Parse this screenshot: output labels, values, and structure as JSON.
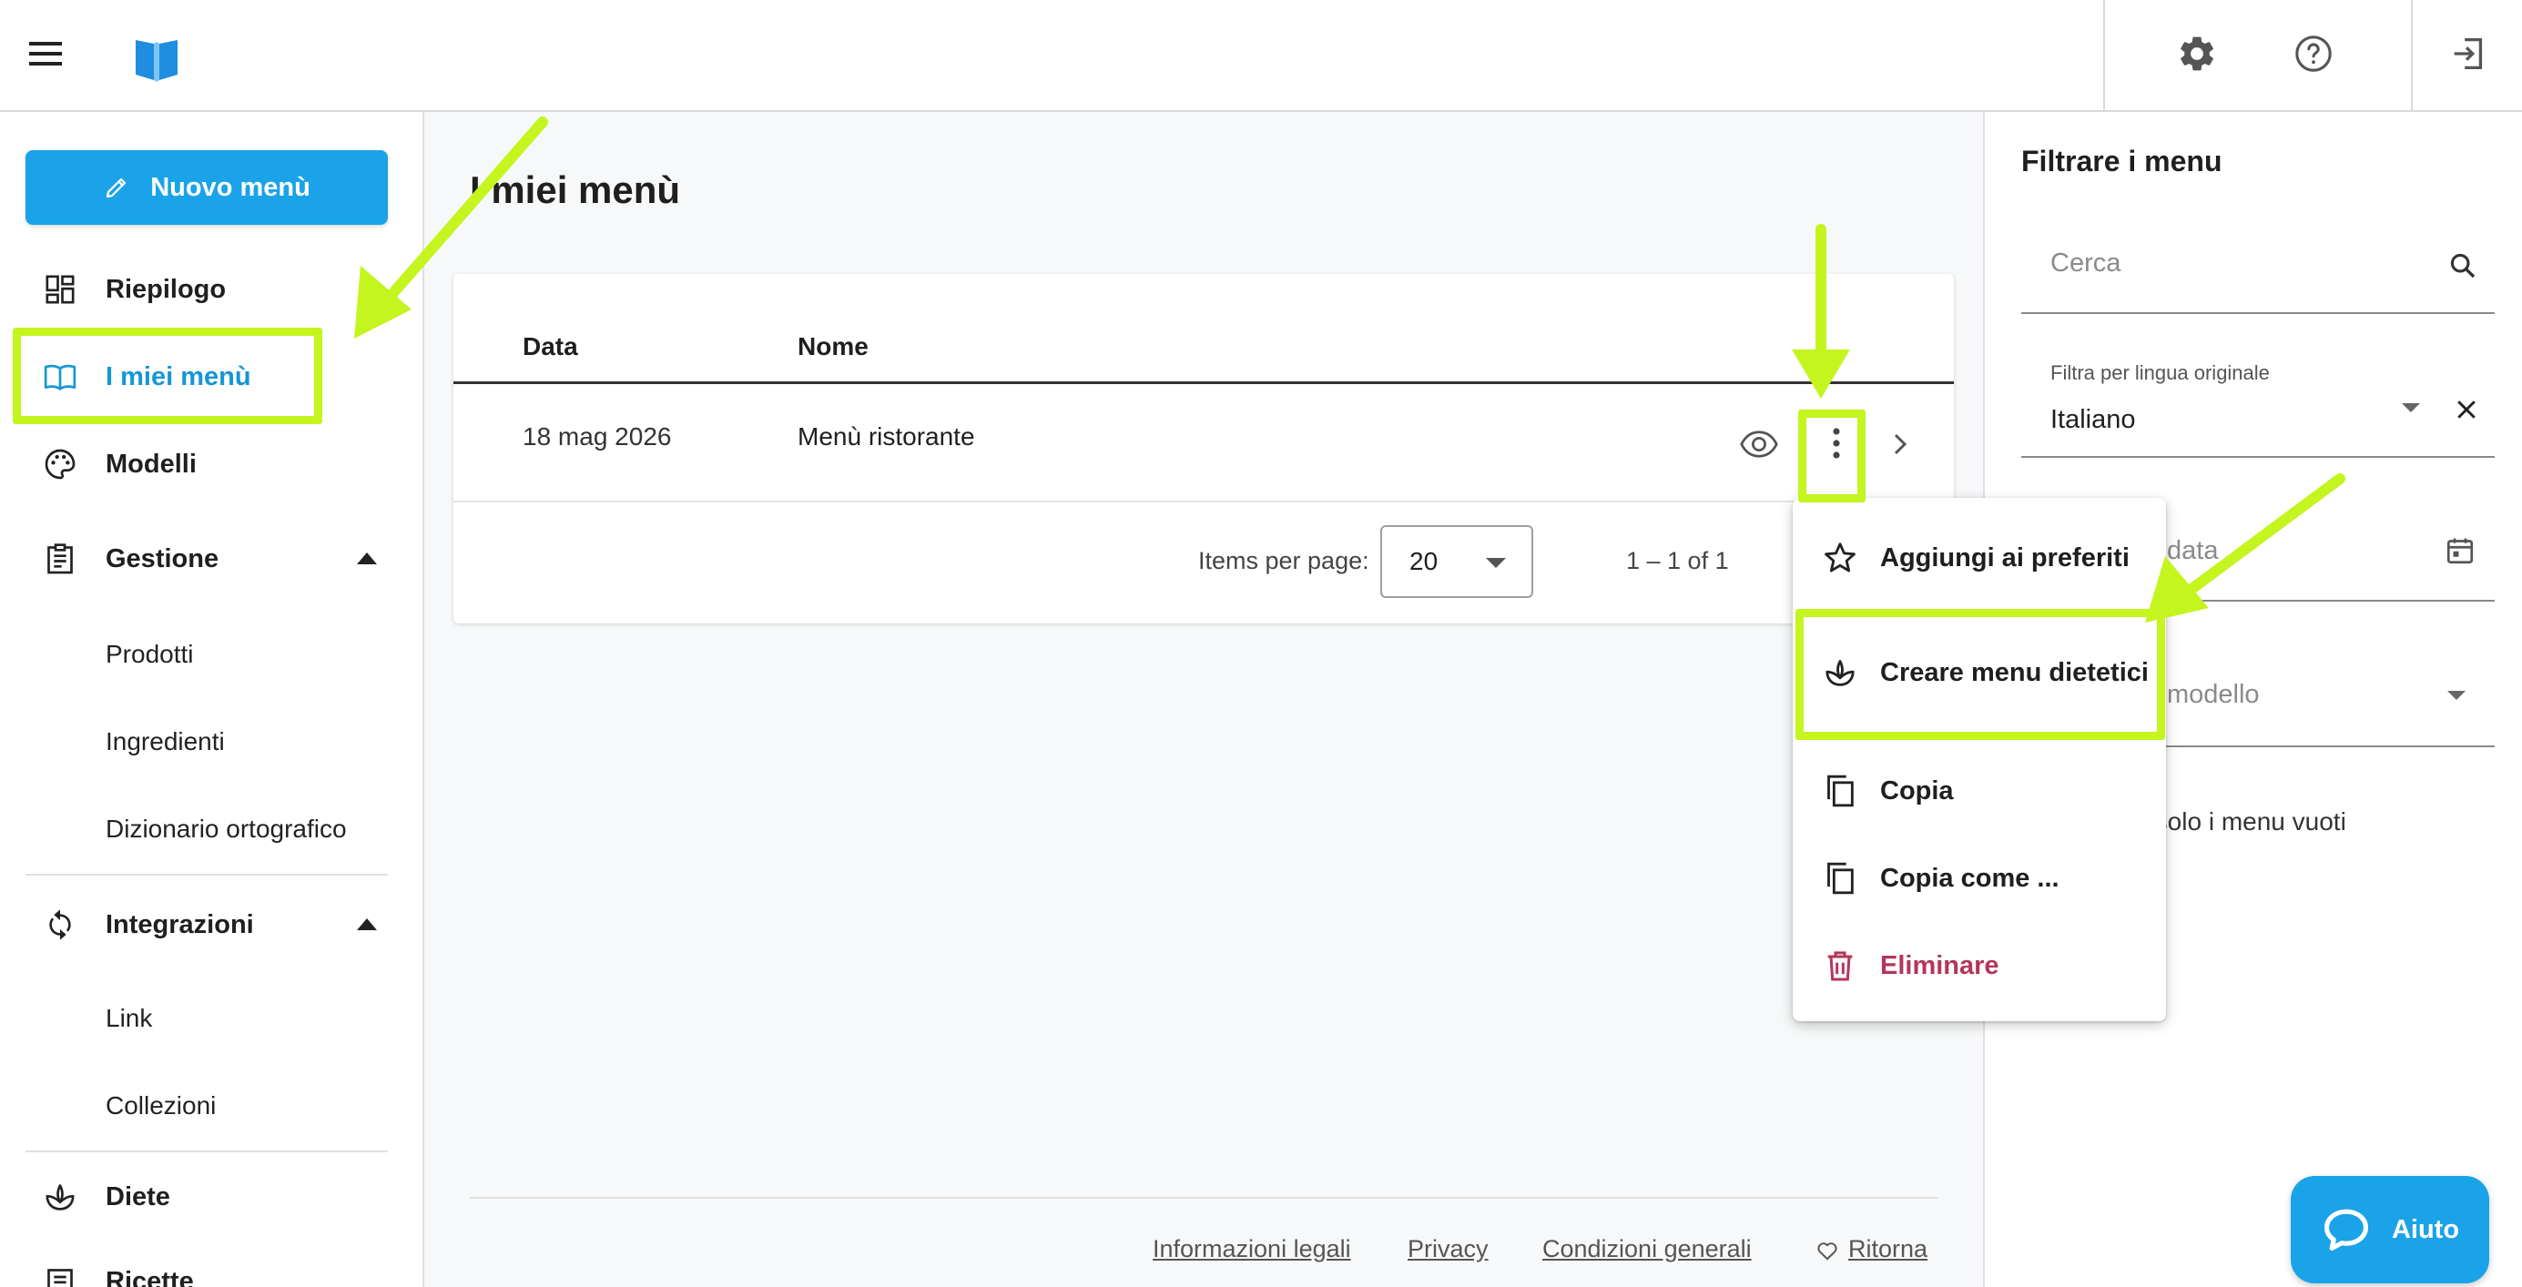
{
  "topbar": {
    "menu_icon": "hamburger-icon",
    "logo_icon": "book-logo-icon",
    "settings_icon": "gear-icon",
    "help_icon": "help-circle-icon",
    "logout_icon": "logout-icon",
    "logo_color": "#1f8de0"
  },
  "sidebar": {
    "new_button_label": "Nuovo menù",
    "items": [
      {
        "label": "Riepilogo",
        "icon": "dashboard-icon"
      },
      {
        "label": "I miei menù",
        "icon": "open-book-icon",
        "active": true
      },
      {
        "label": "Modelli",
        "icon": "palette-icon"
      },
      {
        "label": "Gestione",
        "icon": "clipboard-icon",
        "expanded": true
      },
      {
        "label": "Integrazioni",
        "icon": "sync-icon",
        "expanded": true
      },
      {
        "label": "Diete",
        "icon": "leaf-icon"
      },
      {
        "label": "Ricette",
        "icon": "recipe-icon"
      }
    ],
    "gestione_children": [
      "Prodotti",
      "Ingredienti",
      "Dizionario ortografico"
    ],
    "integrazioni_children": [
      "Link",
      "Collezioni"
    ]
  },
  "main": {
    "title": "I miei menù",
    "table": {
      "headers": [
        "Data",
        "Nome"
      ],
      "rows": [
        {
          "date": "18 mag 2026",
          "name": "Menù ristorante"
        }
      ]
    },
    "pager": {
      "label": "Items per page:",
      "page_size": "20",
      "range": "1 – 1 of 1"
    },
    "footer": {
      "links": [
        "Informazioni legali",
        "Privacy",
        "Condizioni generali",
        "Ritorna"
      ]
    }
  },
  "filters": {
    "title": "Filtrare i menu",
    "search_placeholder": "Cerca",
    "language_label": "Filtra per lingua originale",
    "language_value": "Italiano",
    "date_placeholder": "data",
    "model_placeholder": "modello",
    "empty_only_label": "ra solo i menu vuoti"
  },
  "context_menu": {
    "items": [
      {
        "label": "Aggiungi ai preferiti",
        "icon": "star-outline-icon"
      },
      {
        "label": "Creare menu dietetici",
        "icon": "leaf-outline-icon"
      },
      {
        "label": "Copia",
        "icon": "copy-icon"
      },
      {
        "label": "Copia come ...",
        "icon": "copy-icon"
      },
      {
        "label": "Eliminare",
        "icon": "trash-icon",
        "danger": true
      }
    ]
  },
  "help_button": {
    "label": "Aiuto",
    "icon": "chat-bubble-icon"
  },
  "colors": {
    "accent": "#1aa3e8",
    "active_text": "#1696d6",
    "danger": "#b3365b",
    "annotation": "#c4f51e"
  }
}
